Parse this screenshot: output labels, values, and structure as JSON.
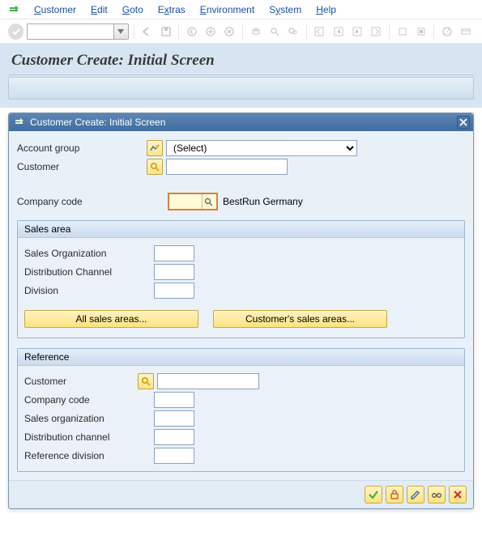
{
  "menu": {
    "items": [
      "Customer",
      "Edit",
      "Goto",
      "Extras",
      "Environment",
      "System",
      "Help"
    ],
    "accelerator_positions": [
      0,
      0,
      0,
      1,
      0,
      1,
      0
    ]
  },
  "page": {
    "title": "Customer Create: Initial Screen"
  },
  "dialog": {
    "title": "Customer Create: Initial Screen",
    "account_group_label": "Account group",
    "account_group_value": "(Select)",
    "customer_label": "Customer",
    "company_code_label": "Company code",
    "company_code_value": "",
    "company_code_text": "BestRun Germany",
    "sales_area": {
      "title": "Sales area",
      "sales_org_label": "Sales Organization",
      "dist_channel_label": "Distribution Channel",
      "division_label": "Division",
      "btn_all": "All sales areas...",
      "btn_customer": "Customer's sales areas..."
    },
    "reference": {
      "title": "Reference",
      "customer_label": "Customer",
      "company_code_label": "Company code",
      "sales_org_label": "Sales organization",
      "dist_channel_label": "Distribution channel",
      "ref_div_label": "Reference division"
    }
  }
}
